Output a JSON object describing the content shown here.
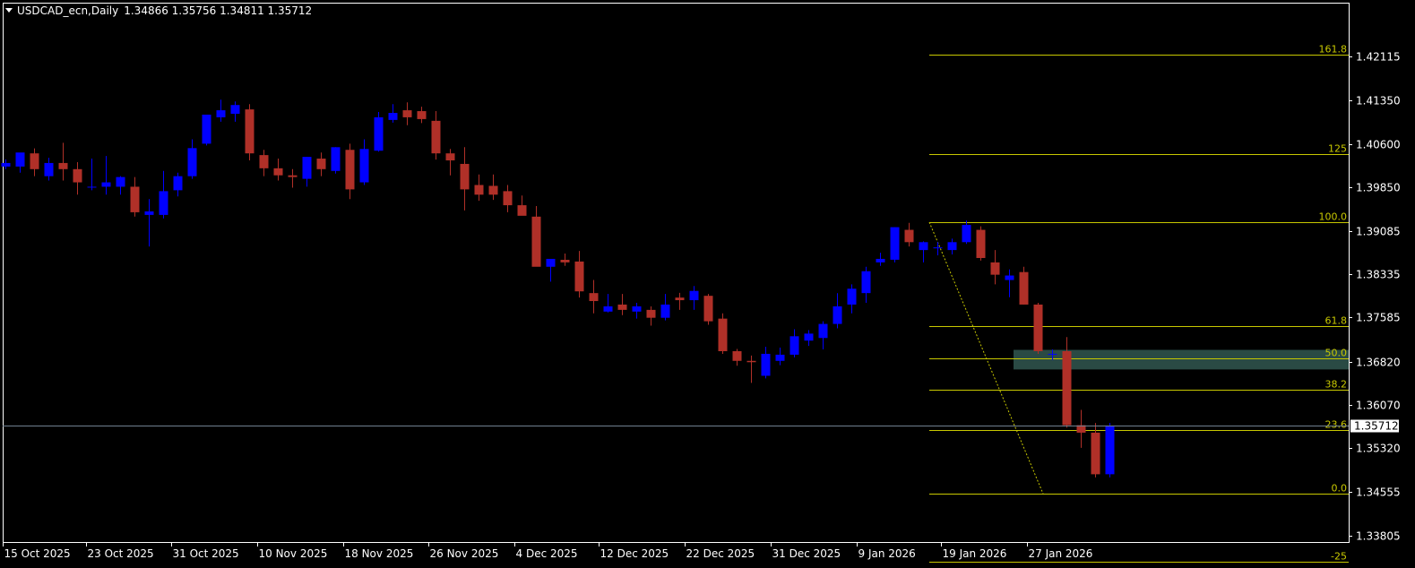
{
  "header": {
    "symbol": "USDCAD_ecn,Daily",
    "ohlc": "1.34866 1.35756 1.34811 1.35712"
  },
  "colors": {
    "background": "#000000",
    "foreground": "#ffffff",
    "bull": "#0000ff",
    "bear": "#b03028",
    "fib": "#c8c800",
    "zone": "#2a4a44",
    "price_line": "#708090"
  },
  "price_axis": {
    "labels": [
      "1.42115",
      "1.41350",
      "1.40600",
      "1.39850",
      "1.39085",
      "1.38335",
      "1.37585",
      "1.36820",
      "1.36070",
      "1.35320",
      "1.34555",
      "1.33805"
    ],
    "current": "1.35712"
  },
  "time_axis": {
    "labels": [
      "15 Oct 2025",
      "23 Oct 2025",
      "31 Oct 2025",
      "10 Nov 2025",
      "18 Nov 2025",
      "26 Nov 2025",
      "4 Dec 2025",
      "12 Dec 2025",
      "22 Dec 2025",
      "31 Dec 2025",
      "9 Jan 2026",
      "19 Jan 2026",
      "27 Jan 2026"
    ]
  },
  "fibonacci": {
    "labels": [
      "161.8",
      "125",
      "100.0",
      "61.8",
      "50.0",
      "38.2",
      "23.6",
      "0.0",
      "-25"
    ],
    "levels": [
      1.42155,
      1.40421,
      1.39242,
      1.37442,
      1.36885,
      1.36329,
      1.3564,
      1.34528,
      1.3335
    ]
  },
  "chart_data": {
    "type": "candlestick",
    "x_range": [
      "15 Oct 2025",
      "27 Jan 2026"
    ],
    "y_range": [
      1.3369,
      1.4305
    ],
    "candles": [
      {
        "o": 1.40206,
        "h": 1.40329,
        "l": 1.40161,
        "c": 1.40268
      },
      {
        "o": 1.40206,
        "h": 1.40435,
        "l": 1.401,
        "c": 1.4045
      },
      {
        "o": 1.40435,
        "h": 1.40521,
        "l": 1.40039,
        "c": 1.40161
      },
      {
        "o": 1.40039,
        "h": 1.40359,
        "l": 1.39963,
        "c": 1.40268
      },
      {
        "o": 1.40268,
        "h": 1.40618,
        "l": 1.39963,
        "c": 1.40161
      },
      {
        "o": 1.40161,
        "h": 1.40283,
        "l": 1.39718,
        "c": 1.39932
      },
      {
        "o": 1.39856,
        "h": 1.40344,
        "l": 1.39795,
        "c": 1.39856
      },
      {
        "o": 1.39856,
        "h": 1.40389,
        "l": 1.39718,
        "c": 1.39932
      },
      {
        "o": 1.39856,
        "h": 1.40039,
        "l": 1.39718,
        "c": 1.40024
      },
      {
        "o": 1.39856,
        "h": 1.40024,
        "l": 1.39337,
        "c": 1.39413
      },
      {
        "o": 1.39367,
        "h": 1.39642,
        "l": 1.38818,
        "c": 1.39428
      },
      {
        "o": 1.39367,
        "h": 1.4013,
        "l": 1.39306,
        "c": 1.39779
      },
      {
        "o": 1.39795,
        "h": 1.401,
        "l": 1.39688,
        "c": 1.40039
      },
      {
        "o": 1.40039,
        "h": 1.40679,
        "l": 1.39993,
        "c": 1.40526
      },
      {
        "o": 1.40603,
        "h": 1.41076,
        "l": 1.40572,
        "c": 1.41107
      },
      {
        "o": 1.41061,
        "h": 1.41366,
        "l": 1.40984,
        "c": 1.41183
      },
      {
        "o": 1.41122,
        "h": 1.41335,
        "l": 1.40984,
        "c": 1.41274
      },
      {
        "o": 1.41198,
        "h": 1.4129,
        "l": 1.40313,
        "c": 1.40435
      },
      {
        "o": 1.40405,
        "h": 1.40496,
        "l": 1.40039,
        "c": 1.40176
      },
      {
        "o": 1.40176,
        "h": 1.40344,
        "l": 1.39963,
        "c": 1.40054
      },
      {
        "o": 1.40054,
        "h": 1.40161,
        "l": 1.3984,
        "c": 1.40024
      },
      {
        "o": 1.39993,
        "h": 1.40374,
        "l": 1.39856,
        "c": 1.40374
      },
      {
        "o": 1.40344,
        "h": 1.4045,
        "l": 1.40039,
        "c": 1.40161
      },
      {
        "o": 1.4013,
        "h": 1.40542,
        "l": 1.40084,
        "c": 1.40542
      },
      {
        "o": 1.40496,
        "h": 1.40603,
        "l": 1.39642,
        "c": 1.3981
      },
      {
        "o": 1.39932,
        "h": 1.40679,
        "l": 1.39886,
        "c": 1.40511
      },
      {
        "o": 1.40481,
        "h": 1.41153,
        "l": 1.40465,
        "c": 1.41061
      },
      {
        "o": 1.41015,
        "h": 1.4129,
        "l": 1.40969,
        "c": 1.41137
      },
      {
        "o": 1.41183,
        "h": 1.4132,
        "l": 1.40923,
        "c": 1.41061
      },
      {
        "o": 1.41168,
        "h": 1.41244,
        "l": 1.40961,
        "c": 1.4103
      },
      {
        "o": 1.41,
        "h": 1.41168,
        "l": 1.40328,
        "c": 1.40435
      },
      {
        "o": 1.40435,
        "h": 1.40511,
        "l": 1.40054,
        "c": 1.40313
      },
      {
        "o": 1.40252,
        "h": 1.40542,
        "l": 1.39444,
        "c": 1.3981
      },
      {
        "o": 1.39886,
        "h": 1.40069,
        "l": 1.39612,
        "c": 1.39718
      },
      {
        "o": 1.39871,
        "h": 1.40069,
        "l": 1.39627,
        "c": 1.39718
      },
      {
        "o": 1.39779,
        "h": 1.39886,
        "l": 1.39413,
        "c": 1.39535
      },
      {
        "o": 1.39535,
        "h": 1.39703,
        "l": 1.39428,
        "c": 1.39352
      },
      {
        "o": 1.39337,
        "h": 1.3952,
        "l": 1.38513,
        "c": 1.38467
      },
      {
        "o": 1.38467,
        "h": 1.38574,
        "l": 1.38208,
        "c": 1.38604
      },
      {
        "o": 1.38588,
        "h": 1.38696,
        "l": 1.38482,
        "c": 1.38543
      },
      {
        "o": 1.38558,
        "h": 1.38741,
        "l": 1.37933,
        "c": 1.3804
      },
      {
        "o": 1.3801,
        "h": 1.38238,
        "l": 1.37658,
        "c": 1.37872
      },
      {
        "o": 1.37689,
        "h": 1.37994,
        "l": 1.37674,
        "c": 1.3778
      },
      {
        "o": 1.37811,
        "h": 1.37994,
        "l": 1.37628,
        "c": 1.37719
      },
      {
        "o": 1.37689,
        "h": 1.37841,
        "l": 1.37567,
        "c": 1.3778
      },
      {
        "o": 1.37719,
        "h": 1.3778,
        "l": 1.37445,
        "c": 1.37582
      },
      {
        "o": 1.37582,
        "h": 1.37994,
        "l": 1.37536,
        "c": 1.37811
      },
      {
        "o": 1.37932,
        "h": 1.38014,
        "l": 1.37719,
        "c": 1.37887
      },
      {
        "o": 1.37887,
        "h": 1.38133,
        "l": 1.37719,
        "c": 1.38048
      },
      {
        "o": 1.37963,
        "h": 1.37994,
        "l": 1.3746,
        "c": 1.37521
      },
      {
        "o": 1.37567,
        "h": 1.37658,
        "l": 1.36956,
        "c": 1.37002
      },
      {
        "o": 1.37002,
        "h": 1.3704,
        "l": 1.36749,
        "c": 1.36834
      },
      {
        "o": 1.36834,
        "h": 1.36925,
        "l": 1.36452,
        "c": 1.36811
      },
      {
        "o": 1.36575,
        "h": 1.37078,
        "l": 1.36529,
        "c": 1.36956
      },
      {
        "o": 1.36834,
        "h": 1.37063,
        "l": 1.36758,
        "c": 1.36941
      },
      {
        "o": 1.36941,
        "h": 1.37383,
        "l": 1.36895,
        "c": 1.37261
      },
      {
        "o": 1.37185,
        "h": 1.37368,
        "l": 1.37094,
        "c": 1.37307
      },
      {
        "o": 1.37231,
        "h": 1.37521,
        "l": 1.37033,
        "c": 1.37475
      },
      {
        "o": 1.37475,
        "h": 1.38009,
        "l": 1.37399,
        "c": 1.3778
      },
      {
        "o": 1.37811,
        "h": 1.38162,
        "l": 1.37658,
        "c": 1.38086
      },
      {
        "o": 1.3801,
        "h": 1.38467,
        "l": 1.37842,
        "c": 1.3839
      },
      {
        "o": 1.38543,
        "h": 1.38711,
        "l": 1.38482,
        "c": 1.38604
      },
      {
        "o": 1.38589,
        "h": 1.39154,
        "l": 1.38543,
        "c": 1.39154
      },
      {
        "o": 1.39108,
        "h": 1.3923,
        "l": 1.38818,
        "c": 1.38894
      },
      {
        "o": 1.38757,
        "h": 1.38909,
        "l": 1.38543,
        "c": 1.38894
      },
      {
        "o": 1.38787,
        "h": 1.38894,
        "l": 1.38665,
        "c": 1.38803
      },
      {
        "o": 1.38757,
        "h": 1.38955,
        "l": 1.3868,
        "c": 1.38894
      },
      {
        "o": 1.38894,
        "h": 1.39269,
        "l": 1.38864,
        "c": 1.39193
      },
      {
        "o": 1.39108,
        "h": 1.39169,
        "l": 1.38574,
        "c": 1.38619
      },
      {
        "o": 1.38543,
        "h": 1.38757,
        "l": 1.38162,
        "c": 1.38329
      },
      {
        "o": 1.38237,
        "h": 1.38421,
        "l": 1.37939,
        "c": 1.38315
      },
      {
        "o": 1.38375,
        "h": 1.38467,
        "l": 1.37811,
        "c": 1.37811
      },
      {
        "o": 1.37811,
        "h": 1.37841,
        "l": 1.36956,
        "c": 1.37002
      },
      {
        "o": 1.36956,
        "h": 1.37033,
        "l": 1.36849,
        "c": 1.36956
      },
      {
        "o": 1.37002,
        "h": 1.37246,
        "l": 1.35674,
        "c": 1.35718
      },
      {
        "o": 1.35718,
        "h": 1.35984,
        "l": 1.35324,
        "c": 1.35588
      },
      {
        "o": 1.35588,
        "h": 1.35756,
        "l": 1.34811,
        "c": 1.34866
      },
      {
        "o": 1.34866,
        "h": 1.35756,
        "l": 1.34811,
        "c": 1.35712
      }
    ],
    "fib_retracement": {
      "start": {
        "date": "13 Jan 2026",
        "price": 1.39242
      },
      "end": {
        "date": "27 Jan 2026",
        "price": 1.34528
      }
    },
    "zone": {
      "from": 1.36685,
      "to": 1.37025
    },
    "current_price": 1.35712
  }
}
